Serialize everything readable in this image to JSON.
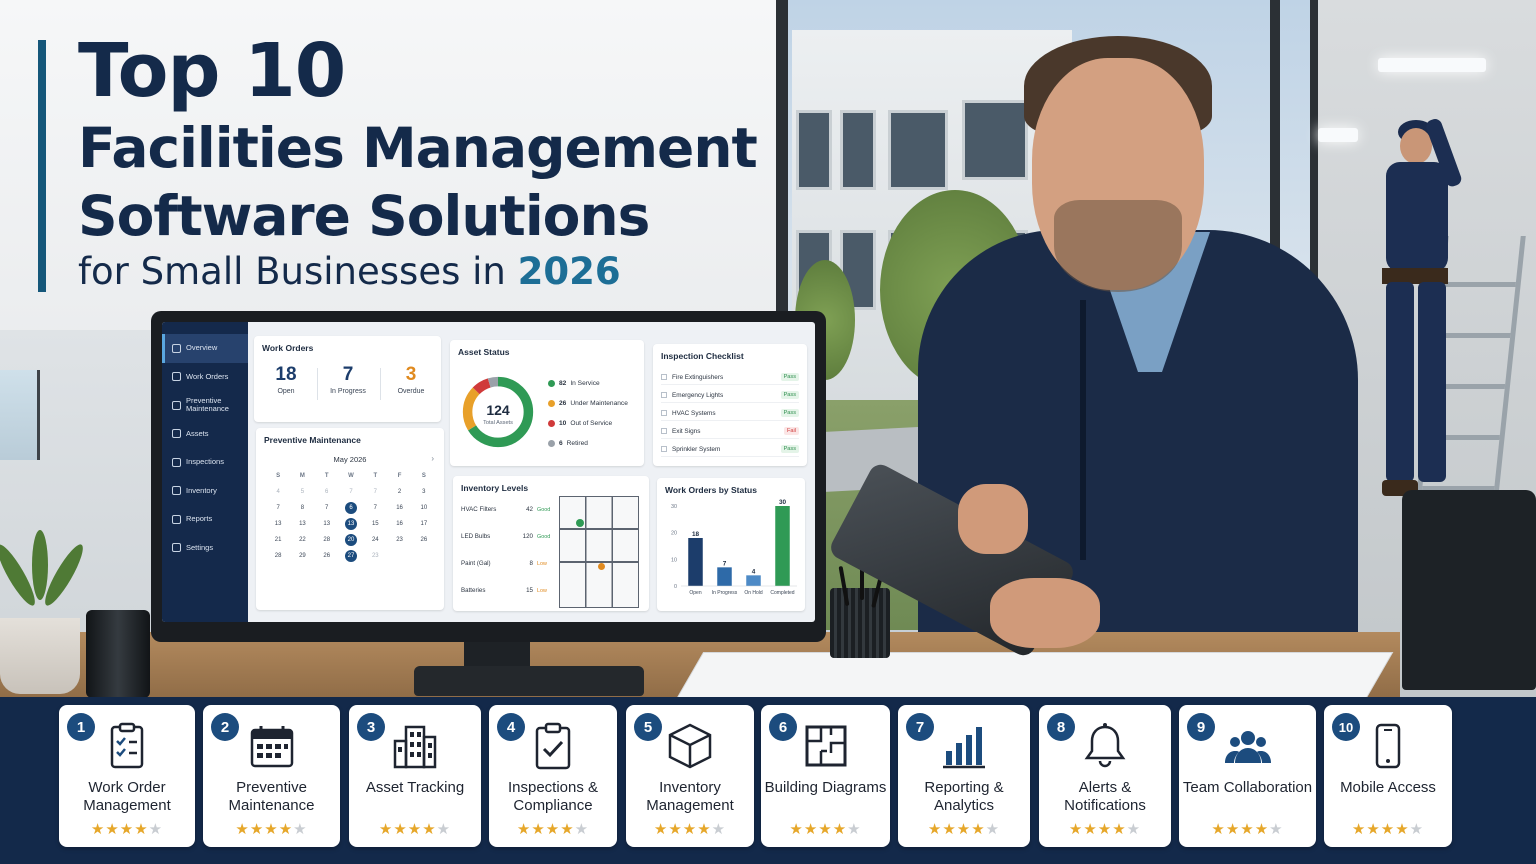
{
  "headline": {
    "line1": "Top 10",
    "line2": "Facilities Management",
    "line3": "Software Solutions",
    "line4_prefix": "for Small Businesses in ",
    "line4_year": "2026"
  },
  "dashboard": {
    "sidebar": [
      {
        "label": "Overview",
        "icon": "home-icon",
        "active": true
      },
      {
        "label": "Work Orders",
        "icon": "wrench-icon"
      },
      {
        "label": "Preventive Maintenance",
        "icon": "clock-icon"
      },
      {
        "label": "Assets",
        "icon": "box-icon"
      },
      {
        "label": "Inspections",
        "icon": "clipboard-icon"
      },
      {
        "label": "Inventory",
        "icon": "inventory-icon"
      },
      {
        "label": "Reports",
        "icon": "chart-icon"
      },
      {
        "label": "Settings",
        "icon": "gear-icon"
      }
    ],
    "work_orders": {
      "title": "Work Orders",
      "stats": [
        {
          "value": "18",
          "label": "Open",
          "color": "#1c3d6b"
        },
        {
          "value": "7",
          "label": "In Progress",
          "color": "#1c3d6b"
        },
        {
          "value": "3",
          "label": "Overdue",
          "color": "#e08a1f"
        }
      ]
    },
    "asset_status": {
      "title": "Asset Status",
      "total": "124",
      "total_label": "Total Assets",
      "legend": [
        {
          "value": 82,
          "label": "In Service",
          "color": "#2f9a55"
        },
        {
          "value": 26,
          "label": "Under Maintenance",
          "color": "#e8a02a"
        },
        {
          "value": 10,
          "label": "Out of Service",
          "color": "#d03a3a"
        },
        {
          "value": 6,
          "label": "Retired",
          "color": "#9aa1a9"
        }
      ]
    },
    "inspection_checklist": {
      "title": "Inspection Checklist",
      "items": [
        {
          "name": "Fire Extinguishers",
          "status": "Pass"
        },
        {
          "name": "Emergency Lights",
          "status": "Pass"
        },
        {
          "name": "HVAC Systems",
          "status": "Pass"
        },
        {
          "name": "Exit Signs",
          "status": "Fail"
        },
        {
          "name": "Sprinkler System",
          "status": "Pass"
        }
      ]
    },
    "preventive_maintenance": {
      "title": "Preventive Maintenance",
      "month": "May 2026",
      "next_icon": "chevron-right-icon",
      "weekdays": [
        "S",
        "M",
        "T",
        "W",
        "T",
        "F",
        "S"
      ],
      "days": [
        {
          "d": "4",
          "muted": true
        },
        {
          "d": "5",
          "muted": true
        },
        {
          "d": "6",
          "muted": true
        },
        {
          "d": "7",
          "muted": true
        },
        {
          "d": "7",
          "muted": true
        },
        {
          "d": "2"
        },
        {
          "d": "3"
        },
        {
          "d": "7"
        },
        {
          "d": "8"
        },
        {
          "d": "7"
        },
        {
          "d": "6",
          "mark": true
        },
        {
          "d": "7"
        },
        {
          "d": "16"
        },
        {
          "d": "10"
        },
        {
          "d": "13"
        },
        {
          "d": "13"
        },
        {
          "d": "13"
        },
        {
          "d": "13",
          "mark": true
        },
        {
          "d": "15"
        },
        {
          "d": "16"
        },
        {
          "d": "17"
        },
        {
          "d": "21"
        },
        {
          "d": "22"
        },
        {
          "d": "28"
        },
        {
          "d": "20",
          "mark": true
        },
        {
          "d": "24"
        },
        {
          "d": "23"
        },
        {
          "d": "26"
        },
        {
          "d": "28"
        },
        {
          "d": "29"
        },
        {
          "d": "26"
        },
        {
          "d": "27",
          "mark": true
        },
        {
          "d": "23",
          "muted": true
        },
        {
          "d": ""
        },
        {
          "d": ""
        }
      ]
    },
    "inventory_levels": {
      "title": "Inventory Levels",
      "items": [
        {
          "name": "HVAC Filters",
          "qty": "42",
          "status": "Good"
        },
        {
          "name": "LED Bulbs",
          "qty": "120",
          "status": "Good"
        },
        {
          "name": "Paint (Gal)",
          "qty": "8",
          "status": "Low"
        },
        {
          "name": "Batteries",
          "qty": "15",
          "status": "Low"
        }
      ]
    },
    "work_orders_by_status": {
      "title": "Work Orders by Status"
    }
  },
  "chart_data": {
    "type": "bar",
    "categories": [
      "Open",
      "In Progress",
      "On Hold",
      "Completed"
    ],
    "values": [
      18,
      7,
      4,
      30
    ],
    "colors": [
      "#1c3d6b",
      "#2e6aa8",
      "#4d8ac6",
      "#2f9a55"
    ],
    "yticks": [
      0,
      10,
      20,
      30
    ],
    "ylim": [
      0,
      30
    ],
    "title": "Work Orders by Status",
    "grid": false
  },
  "features": [
    {
      "num": "1",
      "label": "Work Order Management",
      "icon": "clipboard-checklist-icon",
      "rating": 4.5
    },
    {
      "num": "2",
      "label": "Preventive Maintenance",
      "icon": "calendar-icon",
      "rating": 4.5
    },
    {
      "num": "3",
      "label": "Asset Tracking",
      "icon": "building-icon",
      "rating": 4.5
    },
    {
      "num": "4",
      "label": "Inspections & Compliance",
      "icon": "clipboard-check-icon",
      "rating": 4.5
    },
    {
      "num": "5",
      "label": "Inventory Management",
      "icon": "package-icon",
      "rating": 4.5
    },
    {
      "num": "6",
      "label": "Building Diagrams",
      "icon": "floor-plan-icon",
      "rating": 4.5
    },
    {
      "num": "7",
      "label": "Reporting & Analytics",
      "icon": "bar-chart-icon",
      "rating": 4.5
    },
    {
      "num": "8",
      "label": "Alerts & Notifications",
      "icon": "bell-icon",
      "rating": 4.5
    },
    {
      "num": "9",
      "label": "Team Collaboration",
      "icon": "team-icon",
      "rating": 4.5
    },
    {
      "num": "10",
      "label": "Mobile Access",
      "icon": "smartphone-icon",
      "rating": 4.5
    }
  ],
  "colors": {
    "navy": "#142a4a",
    "accent": "#1d6e96",
    "badge": "#1c4c7e",
    "star": "#e6a72a"
  }
}
